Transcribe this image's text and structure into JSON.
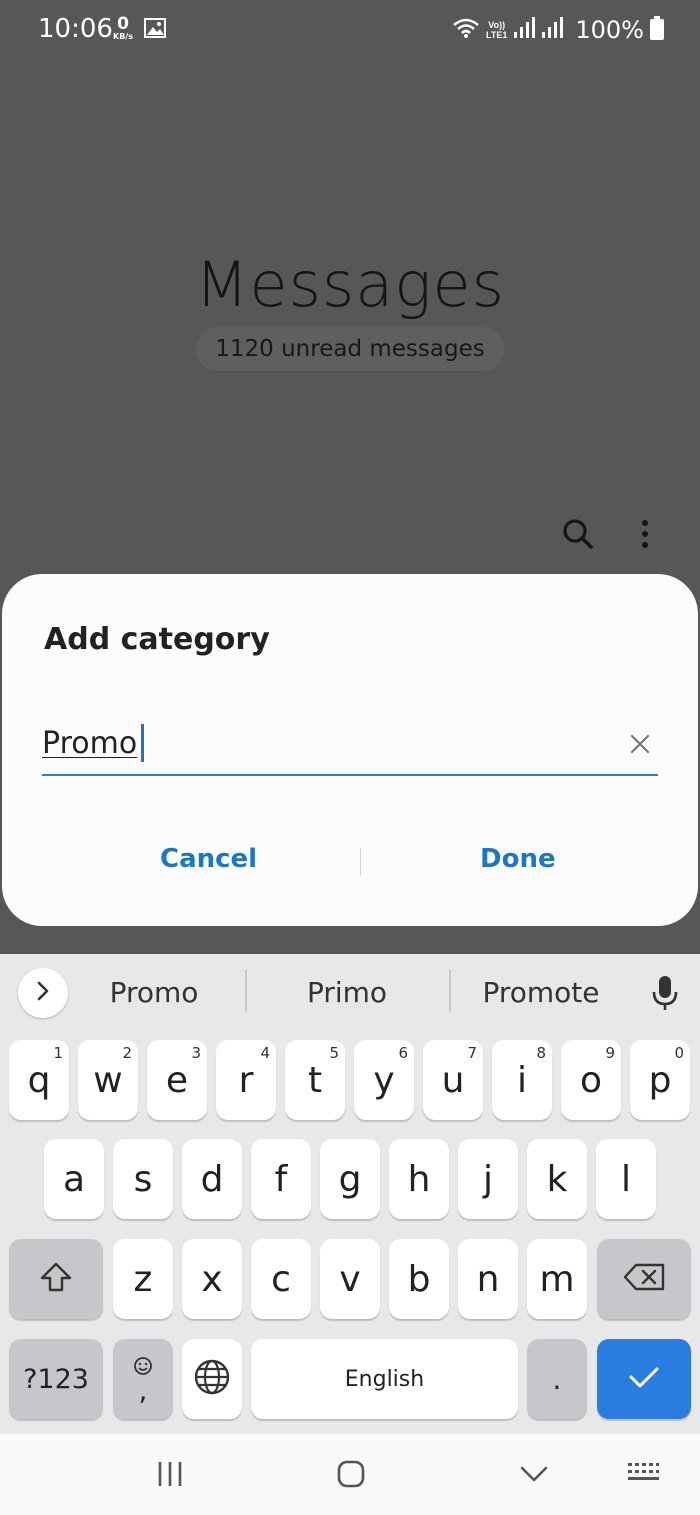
{
  "status_bar": {
    "time": "10:06",
    "net_speed_value": "0",
    "net_speed_unit": "KB/s",
    "image_icon": "image-icon",
    "wifi_icon": "wifi-icon",
    "volte_label_1": "Vo))",
    "volte_label_2": "LTE1",
    "battery_percent": "100%"
  },
  "app": {
    "title": "Messages",
    "unread": "1120 unread messages"
  },
  "dialog": {
    "title": "Add category",
    "input_value": "Promo",
    "cancel_label": "Cancel",
    "done_label": "Done"
  },
  "keyboard": {
    "suggestions": [
      "Promo",
      "Primo",
      "Promote"
    ],
    "row1": [
      {
        "key": "q",
        "hint": "1"
      },
      {
        "key": "w",
        "hint": "2"
      },
      {
        "key": "e",
        "hint": "3"
      },
      {
        "key": "r",
        "hint": "4"
      },
      {
        "key": "t",
        "hint": "5"
      },
      {
        "key": "y",
        "hint": "6"
      },
      {
        "key": "u",
        "hint": "7"
      },
      {
        "key": "i",
        "hint": "8"
      },
      {
        "key": "o",
        "hint": "9"
      },
      {
        "key": "p",
        "hint": "0"
      }
    ],
    "row2": [
      "a",
      "s",
      "d",
      "f",
      "g",
      "h",
      "j",
      "k",
      "l"
    ],
    "row3": [
      "z",
      "x",
      "c",
      "v",
      "b",
      "n",
      "m"
    ],
    "symbols_label": "?123",
    "emoji_comma": ",",
    "space_label": "English",
    "period_label": ".",
    "accent_color": "#2a7de1"
  },
  "colors": {
    "scrim": "#575757",
    "dialog_button": "#1a78c6",
    "field_underline": "#2f7fcf"
  }
}
